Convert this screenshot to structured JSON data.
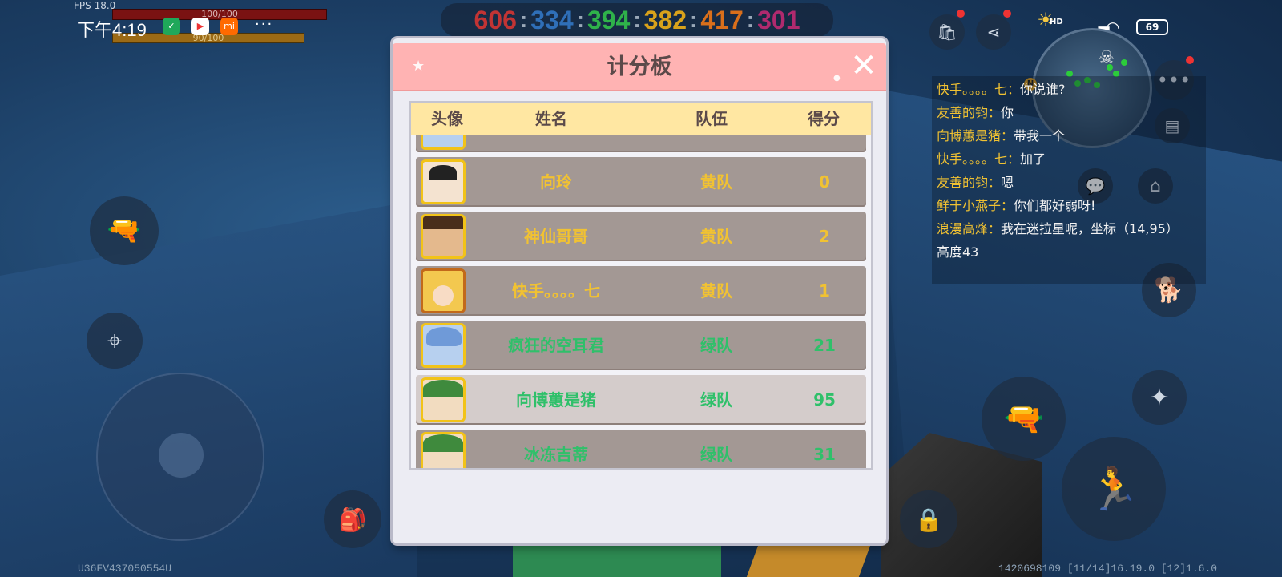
{
  "hud": {
    "fps": "FPS 18.0",
    "hp": "100/100",
    "hunger": "90/100",
    "status_time": "下午4:19",
    "app_icon_3_label": "mi",
    "more": "···",
    "hd": "HD",
    "battery": "69",
    "footer_left": "U36FV437050554U",
    "footer_right": "1420698109  [11/14]16.19.0  [12]1.6.0"
  },
  "team_scores": [
    {
      "value": "606",
      "color": "#c23434"
    },
    {
      "value": "334",
      "color": "#2f6fb8"
    },
    {
      "value": "394",
      "color": "#2fb24a"
    },
    {
      "value": "382",
      "color": "#d9a21b"
    },
    {
      "value": "417",
      "color": "#d96f1b"
    },
    {
      "value": "301",
      "color": "#b02a6e"
    }
  ],
  "scoreboard": {
    "title": "计分板",
    "columns": [
      "头像",
      "姓名",
      "队伍",
      "得分"
    ],
    "rows": [
      {
        "name": "",
        "team": "",
        "score": "",
        "color": "#f1c232",
        "highlight": false,
        "avatar": "avatar-blue-hair"
      },
      {
        "name": "向玲",
        "team": "黄队",
        "score": "0",
        "color": "#f1c232",
        "highlight": false,
        "avatar": "avatar-panda-hood"
      },
      {
        "name": "神仙哥哥",
        "team": "黄队",
        "score": "2",
        "color": "#f1c232",
        "highlight": false,
        "avatar": "avatar-brown-hair"
      },
      {
        "name": "快手。。。。七",
        "team": "黄队",
        "score": "1",
        "color": "#f1c232",
        "highlight": false,
        "avatar": "avatar-blonde-girl"
      },
      {
        "name": "疯狂的空耳君",
        "team": "绿队",
        "score": "21",
        "color": "#2fc06a",
        "highlight": false,
        "avatar": "avatar-blue-hair"
      },
      {
        "name": "向博蕙是猪",
        "team": "绿队",
        "score": "95",
        "color": "#2fc06a",
        "highlight": true,
        "avatar": "avatar-dino-hood"
      },
      {
        "name": "冰冻吉蒂",
        "team": "绿队",
        "score": "31",
        "color": "#2fc06a",
        "highlight": false,
        "avatar": "avatar-dino-hood"
      }
    ]
  },
  "chat": [
    {
      "name": "快手。。。。七",
      "msg": "你说谁?"
    },
    {
      "name": "友善的钧",
      "msg": "你"
    },
    {
      "name": "向博蕙是猪",
      "msg": "带我一个"
    },
    {
      "name": "快手。。。。七",
      "msg": "加了"
    },
    {
      "name": "友善的钧",
      "msg": "嗯"
    },
    {
      "name": "鲜于小燕子",
      "msg": "你们都好弱呀!"
    },
    {
      "name": "浪漫高烽",
      "msg": "我在迷拉星呢，坐标（14,95）"
    },
    {
      "name": "",
      "msg": "高度43"
    }
  ]
}
